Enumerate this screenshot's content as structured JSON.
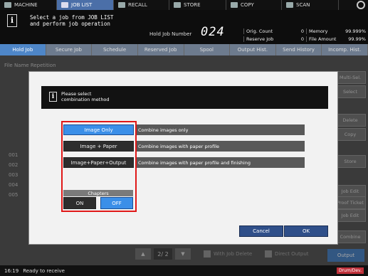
{
  "nav": {
    "tabs": [
      {
        "label": "MACHINE",
        "icon": "machine-icon"
      },
      {
        "label": "JOB LIST",
        "icon": "job-list-icon",
        "active": true
      },
      {
        "label": "RECALL",
        "icon": "recall-icon"
      },
      {
        "label": "STORE",
        "icon": "store-icon"
      },
      {
        "label": "COPY",
        "icon": "copy-icon"
      },
      {
        "label": "SCAN",
        "icon": "scan-icon"
      }
    ]
  },
  "message": {
    "line1": "Select a job from JOB LIST",
    "line2": "and perform job operation"
  },
  "hold_job": {
    "label": "Hold Job Number",
    "number": "024"
  },
  "counters": {
    "orig_count_label": "Orig. Count",
    "orig_count_value": "0",
    "memory_label": "Memory",
    "memory_value": "99.999%",
    "reserve_job_label": "Reserve Job",
    "reserve_job_value": "0",
    "file_amount_label": "File Amount",
    "file_amount_value": "99.99%"
  },
  "job_tabs": [
    "Hold Job",
    "Secure Job",
    "Schedule",
    "Reserved Job",
    "Spool",
    "Output Hist.",
    "Send History",
    "Incomp. Hist."
  ],
  "under": {
    "file_name_repetition": "File Name Repetition",
    "row_numbers": [
      "001",
      "002",
      "003",
      "004",
      "005"
    ],
    "side_buttons": [
      "Multi-Sel.",
      "Select",
      "Delete",
      "Copy",
      "Store",
      "Job Edit",
      "Proof Ticket",
      "Job Edit",
      "Combine"
    ],
    "page_indicator": "2/ 2",
    "with_job_delete": "With Job Delete",
    "direct_output": "Direct Output",
    "output_label": "Output"
  },
  "status": {
    "time": "16:19",
    "ready": "Ready to receive",
    "drum_badge": "Drum/Dev."
  },
  "modal": {
    "message_line1": "Please select",
    "message_line2": "combination method",
    "options": [
      {
        "label": "Image Only",
        "description": "Combine images only",
        "selected": true
      },
      {
        "label": "Image + Paper",
        "description": "Combine images with paper profile",
        "selected": false
      },
      {
        "label": "Image+Paper+Output",
        "description": "Combine images with paper profile and finishing",
        "selected": false
      }
    ],
    "chapters_label": "Chapters",
    "chapters_on": "ON",
    "chapters_off": "OFF",
    "chapters_selected": "OFF",
    "cancel": "Cancel",
    "ok": "OK"
  },
  "colors": {
    "selected_blue": "#3b8fe8",
    "highlight_red": "#e01818",
    "footer_button": "#2f4f89"
  }
}
